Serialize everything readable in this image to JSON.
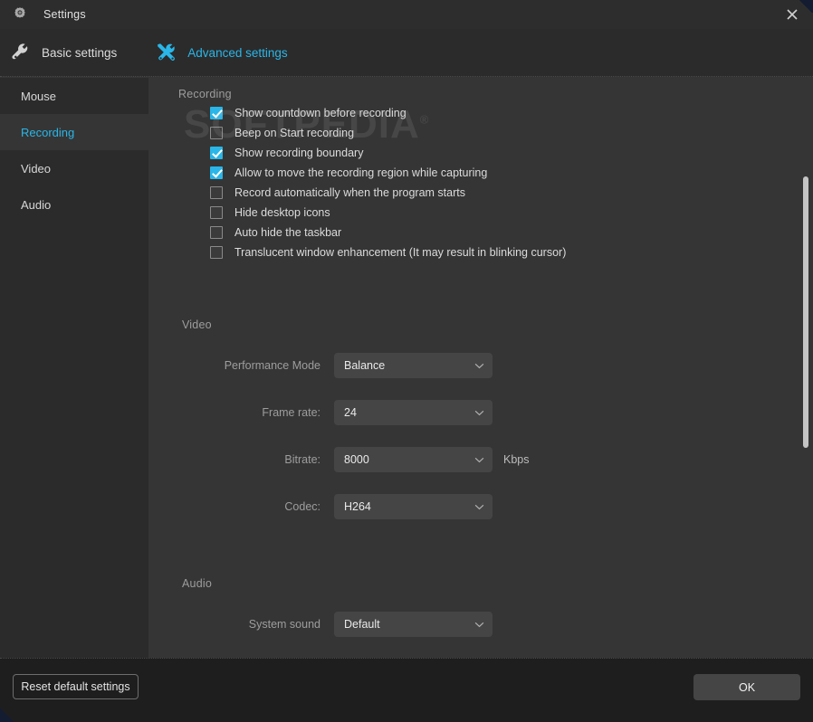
{
  "window": {
    "title": "Settings",
    "gear_icon": "gear-icon",
    "close_icon": "close-icon"
  },
  "tabs": [
    {
      "id": "basic",
      "label": "Basic settings",
      "icon": "wrench-icon",
      "active": false
    },
    {
      "id": "advanced",
      "label": "Advanced settings",
      "icon": "wrench-screwdriver-icon",
      "active": true
    }
  ],
  "sidebar": {
    "items": [
      {
        "label": "Mouse",
        "active": false
      },
      {
        "label": "Recording",
        "active": true
      },
      {
        "label": "Video",
        "active": false
      },
      {
        "label": "Audio",
        "active": false
      }
    ]
  },
  "main": {
    "sections": [
      {
        "id": "recording",
        "title": "Recording",
        "checkboxes": [
          {
            "label": "Show countdown before recording",
            "checked": true
          },
          {
            "label": "Beep on Start recording",
            "checked": false
          },
          {
            "label": "Show recording boundary",
            "checked": true
          },
          {
            "label": "Allow to move the recording region while capturing",
            "checked": true
          },
          {
            "label": "Record automatically when the program starts",
            "checked": false
          },
          {
            "label": "Hide desktop icons",
            "checked": false
          },
          {
            "label": "Auto hide the taskbar",
            "checked": false
          },
          {
            "label": "Translucent window enhancement (It may result in blinking cursor)",
            "checked": false
          }
        ]
      },
      {
        "id": "video",
        "title": "Video",
        "fields": [
          {
            "label": "Performance Mode",
            "value": "Balance",
            "suffix": ""
          },
          {
            "label": "Frame rate:",
            "value": "24",
            "suffix": ""
          },
          {
            "label": "Bitrate:",
            "value": "8000",
            "suffix": "Kbps"
          },
          {
            "label": "Codec:",
            "value": "H264",
            "suffix": ""
          }
        ]
      },
      {
        "id": "audio",
        "title": "Audio",
        "fields": [
          {
            "label": "System sound",
            "value": "Default",
            "suffix": ""
          }
        ]
      }
    ]
  },
  "footer": {
    "reset_label": "Reset default settings",
    "ok_label": "OK"
  },
  "watermark": {
    "text": "SOFTPEDIA",
    "mark": "®"
  },
  "colors": {
    "accent": "#2ab6e8",
    "window_bg": "#353535",
    "sidebar_bg": "#2b2b2b",
    "titlebar_bg": "#2d2d2d",
    "footer_bg": "#1e1e1e",
    "field_bg": "#454545"
  }
}
